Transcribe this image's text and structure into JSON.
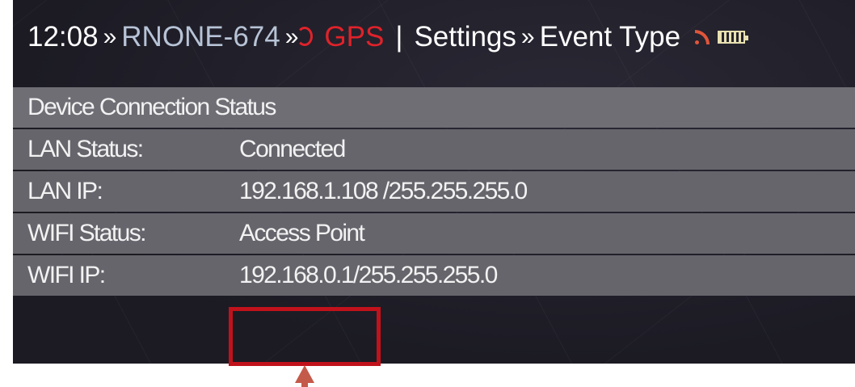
{
  "header": {
    "time": "12:08",
    "separator": "»",
    "device": "RNONE-674",
    "gps_label": "GPS",
    "pipe": "|",
    "section": "Settings",
    "page": "Event Type"
  },
  "table": {
    "title": "Device Connection Status",
    "rows": [
      {
        "label": "LAN Status:",
        "value": "Connected"
      },
      {
        "label": "LAN IP:",
        "value": "192.168.1.108 /255.255.255.0"
      },
      {
        "label": "WIFI Status:",
        "value": "Access Point"
      },
      {
        "label": "WIFI IP:",
        "value": "192.168.0.1/255.255.255.0"
      }
    ]
  },
  "icons": {
    "gps": "gps-icon",
    "signal": "signal-icon",
    "battery": "battery-icon"
  },
  "colors": {
    "accent_red": "#e0222a",
    "device_text": "#b7c3d6",
    "highlight": "#c1121b"
  }
}
